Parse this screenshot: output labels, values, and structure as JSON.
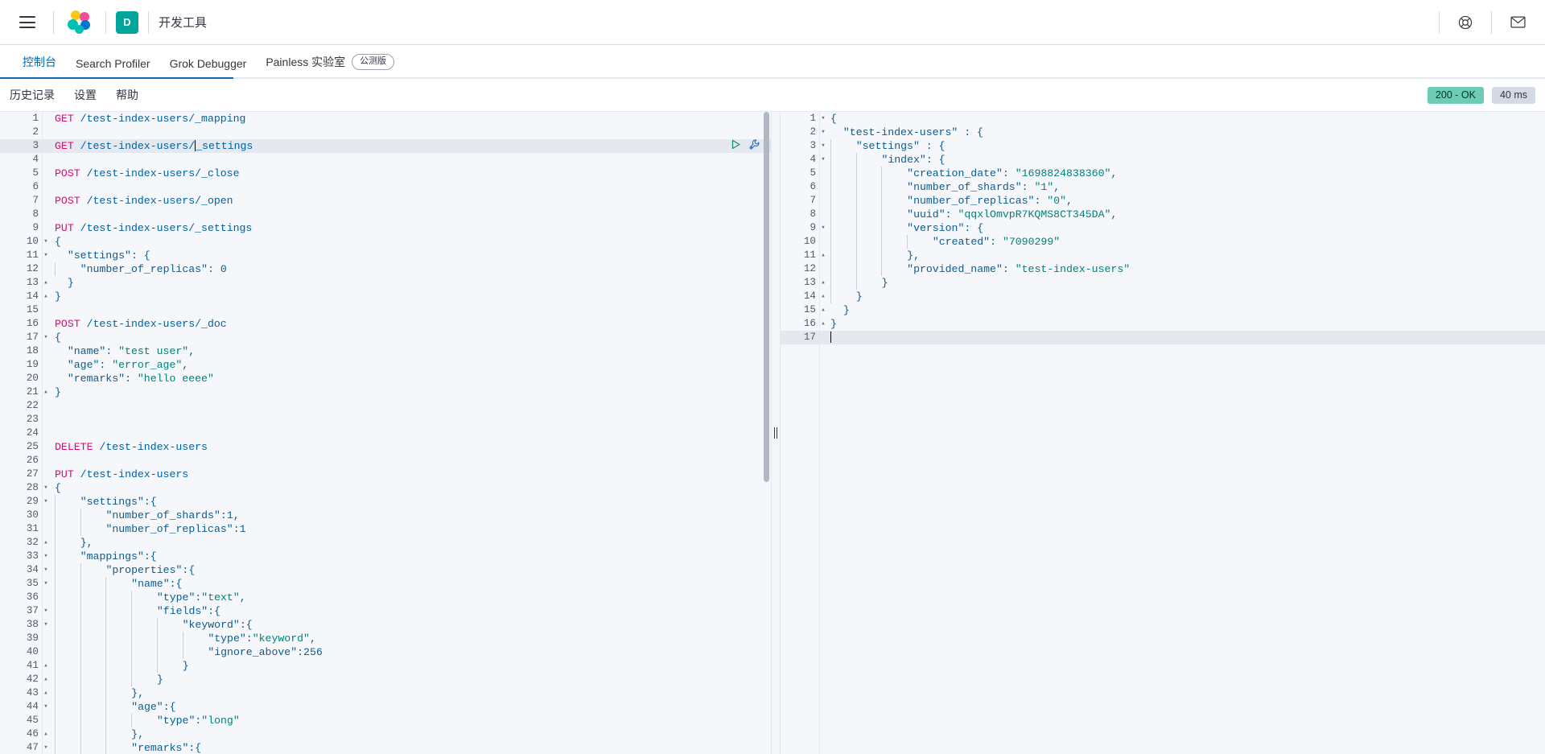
{
  "header": {
    "menu_icon": "hamburger-menu-icon",
    "logo_icon": "elastic-logo-icon",
    "space_initial": "D",
    "app_title": "开发工具",
    "help_icon": "lifebuoy-help-icon",
    "mail_icon": "envelope-icon"
  },
  "app_tabs": [
    {
      "label": "控制台",
      "active": true,
      "badge": null
    },
    {
      "label": "Search Profiler",
      "active": false,
      "badge": null
    },
    {
      "label": "Grok Debugger",
      "active": false,
      "badge": null
    },
    {
      "label": "Painless 实验室",
      "active": false,
      "badge": "公测版"
    }
  ],
  "console_bar": {
    "links": [
      "历史记录",
      "设置",
      "帮助"
    ],
    "status": "200 - OK",
    "time": "40 ms"
  },
  "colors": {
    "accent_blue": "#0071c2",
    "status_green": "#6dccb1",
    "time_grey": "#d3dae6",
    "method_pink": "#dd0a73",
    "string_green": "#00817a",
    "key_blue": "#0a5b8f",
    "teal_avatar": "#00a69b"
  },
  "editor": {
    "active_line": 3,
    "run_icon": "play-triangle-icon",
    "wrench_icon": "wrench-icon",
    "lines": [
      {
        "n": 1,
        "fold": "",
        "indent": 0,
        "tokens": [
          {
            "c": "m",
            "t": "GET"
          },
          {
            "c": "p",
            "t": " "
          },
          {
            "c": "u",
            "t": "/test-index-users/_mapping"
          }
        ]
      },
      {
        "n": 2,
        "fold": "",
        "indent": 0,
        "tokens": []
      },
      {
        "n": 3,
        "fold": "",
        "indent": 0,
        "active": true,
        "tokens": [
          {
            "c": "m",
            "t": "GET"
          },
          {
            "c": "p",
            "t": " "
          },
          {
            "c": "u",
            "t": "/test-index-users/"
          },
          {
            "c": "caret",
            "t": ""
          },
          {
            "c": "u",
            "t": "_settings"
          }
        ]
      },
      {
        "n": 4,
        "fold": "",
        "indent": 0,
        "tokens": []
      },
      {
        "n": 5,
        "fold": "",
        "indent": 0,
        "tokens": [
          {
            "c": "m",
            "t": "POST"
          },
          {
            "c": "p",
            "t": " "
          },
          {
            "c": "u",
            "t": "/test-index-users/_close"
          }
        ]
      },
      {
        "n": 6,
        "fold": "",
        "indent": 0,
        "tokens": []
      },
      {
        "n": 7,
        "fold": "",
        "indent": 0,
        "tokens": [
          {
            "c": "m",
            "t": "POST"
          },
          {
            "c": "p",
            "t": " "
          },
          {
            "c": "u",
            "t": "/test-index-users/_open"
          }
        ]
      },
      {
        "n": 8,
        "fold": "",
        "indent": 0,
        "tokens": []
      },
      {
        "n": 9,
        "fold": "",
        "indent": 0,
        "tokens": [
          {
            "c": "m",
            "t": "PUT"
          },
          {
            "c": "p",
            "t": " "
          },
          {
            "c": "u",
            "t": "/test-index-users/_settings"
          }
        ]
      },
      {
        "n": 10,
        "fold": "down",
        "indent": 0,
        "tokens": [
          {
            "c": "p",
            "t": "{"
          }
        ]
      },
      {
        "n": 11,
        "fold": "down",
        "indent": 0,
        "tokens": [
          {
            "c": "p",
            "t": "  "
          },
          {
            "c": "k",
            "t": "\"settings\""
          },
          {
            "c": "p",
            "t": ": {"
          }
        ]
      },
      {
        "n": 12,
        "fold": "",
        "indent": 1,
        "tokens": [
          {
            "c": "p",
            "t": "    "
          },
          {
            "c": "k",
            "t": "\"number_of_replicas\""
          },
          {
            "c": "p",
            "t": ": "
          },
          {
            "c": "n",
            "t": "0"
          }
        ]
      },
      {
        "n": 13,
        "fold": "up",
        "indent": 0,
        "tokens": [
          {
            "c": "p",
            "t": "  }"
          }
        ]
      },
      {
        "n": 14,
        "fold": "up",
        "indent": 0,
        "tokens": [
          {
            "c": "p",
            "t": "}"
          }
        ]
      },
      {
        "n": 15,
        "fold": "",
        "indent": 0,
        "tokens": []
      },
      {
        "n": 16,
        "fold": "",
        "indent": 0,
        "tokens": [
          {
            "c": "m",
            "t": "POST"
          },
          {
            "c": "p",
            "t": " "
          },
          {
            "c": "u",
            "t": "/test-index-users/_doc"
          }
        ]
      },
      {
        "n": 17,
        "fold": "down",
        "indent": 0,
        "tokens": [
          {
            "c": "p",
            "t": "{"
          }
        ]
      },
      {
        "n": 18,
        "fold": "",
        "indent": 0,
        "tokens": [
          {
            "c": "p",
            "t": "  "
          },
          {
            "c": "k",
            "t": "\"name\""
          },
          {
            "c": "p",
            "t": ": "
          },
          {
            "c": "s",
            "t": "\"test user\""
          },
          {
            "c": "p",
            "t": ","
          }
        ]
      },
      {
        "n": 19,
        "fold": "",
        "indent": 0,
        "tokens": [
          {
            "c": "p",
            "t": "  "
          },
          {
            "c": "k",
            "t": "\"age\""
          },
          {
            "c": "p",
            "t": ": "
          },
          {
            "c": "s",
            "t": "\"error_age\""
          },
          {
            "c": "p",
            "t": ","
          }
        ]
      },
      {
        "n": 20,
        "fold": "",
        "indent": 0,
        "tokens": [
          {
            "c": "p",
            "t": "  "
          },
          {
            "c": "k",
            "t": "\"remarks\""
          },
          {
            "c": "p",
            "t": ": "
          },
          {
            "c": "s",
            "t": "\"hello eeee\""
          }
        ]
      },
      {
        "n": 21,
        "fold": "up",
        "indent": 0,
        "tokens": [
          {
            "c": "p",
            "t": "}"
          }
        ]
      },
      {
        "n": 22,
        "fold": "",
        "indent": 0,
        "tokens": []
      },
      {
        "n": 23,
        "fold": "",
        "indent": 0,
        "tokens": []
      },
      {
        "n": 24,
        "fold": "",
        "indent": 0,
        "tokens": []
      },
      {
        "n": 25,
        "fold": "",
        "indent": 0,
        "tokens": [
          {
            "c": "m",
            "t": "DELETE"
          },
          {
            "c": "p",
            "t": " "
          },
          {
            "c": "u",
            "t": "/test-index-users"
          }
        ]
      },
      {
        "n": 26,
        "fold": "",
        "indent": 0,
        "tokens": []
      },
      {
        "n": 27,
        "fold": "",
        "indent": 0,
        "tokens": [
          {
            "c": "m",
            "t": "PUT"
          },
          {
            "c": "p",
            "t": " "
          },
          {
            "c": "u",
            "t": "/test-index-users"
          }
        ]
      },
      {
        "n": 28,
        "fold": "down",
        "indent": 0,
        "tokens": [
          {
            "c": "p",
            "t": "{"
          }
        ]
      },
      {
        "n": 29,
        "fold": "down",
        "indent": 1,
        "tokens": [
          {
            "c": "p",
            "t": "    "
          },
          {
            "c": "k",
            "t": "\"settings\""
          },
          {
            "c": "p",
            "t": ":{"
          }
        ]
      },
      {
        "n": 30,
        "fold": "",
        "indent": 2,
        "tokens": [
          {
            "c": "p",
            "t": "        "
          },
          {
            "c": "k",
            "t": "\"number_of_shards\""
          },
          {
            "c": "p",
            "t": ":"
          },
          {
            "c": "n",
            "t": "1"
          },
          {
            "c": "p",
            "t": ","
          }
        ]
      },
      {
        "n": 31,
        "fold": "",
        "indent": 2,
        "tokens": [
          {
            "c": "p",
            "t": "        "
          },
          {
            "c": "k",
            "t": "\"number_of_replicas\""
          },
          {
            "c": "p",
            "t": ":"
          },
          {
            "c": "n",
            "t": "1"
          }
        ]
      },
      {
        "n": 32,
        "fold": "up",
        "indent": 1,
        "tokens": [
          {
            "c": "p",
            "t": "    },"
          }
        ]
      },
      {
        "n": 33,
        "fold": "down",
        "indent": 1,
        "tokens": [
          {
            "c": "p",
            "t": "    "
          },
          {
            "c": "k",
            "t": "\"mappings\""
          },
          {
            "c": "p",
            "t": ":{"
          }
        ]
      },
      {
        "n": 34,
        "fold": "down",
        "indent": 2,
        "tokens": [
          {
            "c": "p",
            "t": "        "
          },
          {
            "c": "k",
            "t": "\"properties\""
          },
          {
            "c": "p",
            "t": ":{"
          }
        ]
      },
      {
        "n": 35,
        "fold": "down",
        "indent": 3,
        "tokens": [
          {
            "c": "p",
            "t": "            "
          },
          {
            "c": "k",
            "t": "\"name\""
          },
          {
            "c": "p",
            "t": ":{"
          }
        ]
      },
      {
        "n": 36,
        "fold": "",
        "indent": 4,
        "tokens": [
          {
            "c": "p",
            "t": "                "
          },
          {
            "c": "k",
            "t": "\"type\""
          },
          {
            "c": "p",
            "t": ":"
          },
          {
            "c": "s",
            "t": "\"text\""
          },
          {
            "c": "p",
            "t": ","
          }
        ]
      },
      {
        "n": 37,
        "fold": "down",
        "indent": 4,
        "tokens": [
          {
            "c": "p",
            "t": "                "
          },
          {
            "c": "k",
            "t": "\"fields\""
          },
          {
            "c": "p",
            "t": ":{"
          }
        ]
      },
      {
        "n": 38,
        "fold": "down",
        "indent": 5,
        "tokens": [
          {
            "c": "p",
            "t": "                    "
          },
          {
            "c": "k",
            "t": "\"keyword\""
          },
          {
            "c": "p",
            "t": ":{"
          }
        ]
      },
      {
        "n": 39,
        "fold": "",
        "indent": 6,
        "tokens": [
          {
            "c": "p",
            "t": "                        "
          },
          {
            "c": "k",
            "t": "\"type\""
          },
          {
            "c": "p",
            "t": ":"
          },
          {
            "c": "s",
            "t": "\"keyword\""
          },
          {
            "c": "p",
            "t": ","
          }
        ]
      },
      {
        "n": 40,
        "fold": "",
        "indent": 6,
        "tokens": [
          {
            "c": "p",
            "t": "                        "
          },
          {
            "c": "k",
            "t": "\"ignore_above\""
          },
          {
            "c": "p",
            "t": ":"
          },
          {
            "c": "n",
            "t": "256"
          }
        ]
      },
      {
        "n": 41,
        "fold": "up",
        "indent": 5,
        "tokens": [
          {
            "c": "p",
            "t": "                    }"
          }
        ]
      },
      {
        "n": 42,
        "fold": "up",
        "indent": 4,
        "tokens": [
          {
            "c": "p",
            "t": "                }"
          }
        ]
      },
      {
        "n": 43,
        "fold": "up",
        "indent": 3,
        "tokens": [
          {
            "c": "p",
            "t": "            },"
          }
        ]
      },
      {
        "n": 44,
        "fold": "down",
        "indent": 3,
        "tokens": [
          {
            "c": "p",
            "t": "            "
          },
          {
            "c": "k",
            "t": "\"age\""
          },
          {
            "c": "p",
            "t": ":{"
          }
        ]
      },
      {
        "n": 45,
        "fold": "",
        "indent": 4,
        "tokens": [
          {
            "c": "p",
            "t": "                "
          },
          {
            "c": "k",
            "t": "\"type\""
          },
          {
            "c": "p",
            "t": ":"
          },
          {
            "c": "s",
            "t": "\"long\""
          }
        ]
      },
      {
        "n": 46,
        "fold": "up",
        "indent": 3,
        "tokens": [
          {
            "c": "p",
            "t": "            },"
          }
        ]
      },
      {
        "n": 47,
        "fold": "down",
        "indent": 3,
        "tokens": [
          {
            "c": "p",
            "t": "            "
          },
          {
            "c": "k",
            "t": "\"remarks\""
          },
          {
            "c": "p",
            "t": ":{"
          }
        ]
      }
    ]
  },
  "response": {
    "active_line": 17,
    "lines": [
      {
        "n": 1,
        "fold": "down",
        "indent": 0,
        "tokens": [
          {
            "c": "p",
            "t": "{"
          }
        ]
      },
      {
        "n": 2,
        "fold": "down",
        "indent": 0,
        "tokens": [
          {
            "c": "p",
            "t": "  "
          },
          {
            "c": "k",
            "t": "\"test-index-users\""
          },
          {
            "c": "p",
            "t": " : {"
          }
        ]
      },
      {
        "n": 3,
        "fold": "down",
        "indent": 1,
        "tokens": [
          {
            "c": "p",
            "t": "    "
          },
          {
            "c": "k",
            "t": "\"settings\""
          },
          {
            "c": "p",
            "t": " : {"
          }
        ]
      },
      {
        "n": 4,
        "fold": "down",
        "indent": 2,
        "tokens": [
          {
            "c": "p",
            "t": "      "
          },
          {
            "c": "k",
            "t": "\"index\""
          },
          {
            "c": "p",
            "t": " : {"
          }
        ]
      },
      {
        "n": 5,
        "fold": "",
        "indent": 3,
        "tokens": [
          {
            "c": "p",
            "t": "        "
          },
          {
            "c": "k",
            "t": "\"creation_date\""
          },
          {
            "c": "p",
            "t": " : "
          },
          {
            "c": "s",
            "t": "\"1698824838360\""
          },
          {
            "c": "p",
            "t": ","
          }
        ]
      },
      {
        "n": 6,
        "fold": "",
        "indent": 3,
        "tokens": [
          {
            "c": "p",
            "t": "        "
          },
          {
            "c": "k",
            "t": "\"number_of_shards\""
          },
          {
            "c": "p",
            "t": " : "
          },
          {
            "c": "s",
            "t": "\"1\""
          },
          {
            "c": "p",
            "t": ","
          }
        ]
      },
      {
        "n": 7,
        "fold": "",
        "indent": 3,
        "tokens": [
          {
            "c": "p",
            "t": "        "
          },
          {
            "c": "k",
            "t": "\"number_of_replicas\""
          },
          {
            "c": "p",
            "t": " : "
          },
          {
            "c": "s",
            "t": "\"0\""
          },
          {
            "c": "p",
            "t": ","
          }
        ]
      },
      {
        "n": 8,
        "fold": "",
        "indent": 3,
        "tokens": [
          {
            "c": "p",
            "t": "        "
          },
          {
            "c": "k",
            "t": "\"uuid\""
          },
          {
            "c": "p",
            "t": " : "
          },
          {
            "c": "s",
            "t": "\"qqxlOmvpR7KQMS8CT345DA\""
          },
          {
            "c": "p",
            "t": ","
          }
        ]
      },
      {
        "n": 9,
        "fold": "down",
        "indent": 3,
        "tokens": [
          {
            "c": "p",
            "t": "        "
          },
          {
            "c": "k",
            "t": "\"version\""
          },
          {
            "c": "p",
            "t": " : {"
          }
        ]
      },
      {
        "n": 10,
        "fold": "",
        "indent": 4,
        "tokens": [
          {
            "c": "p",
            "t": "          "
          },
          {
            "c": "k",
            "t": "\"created\""
          },
          {
            "c": "p",
            "t": " : "
          },
          {
            "c": "s",
            "t": "\"7090299\""
          }
        ]
      },
      {
        "n": 11,
        "fold": "up",
        "indent": 3,
        "tokens": [
          {
            "c": "p",
            "t": "        },"
          }
        ]
      },
      {
        "n": 12,
        "fold": "",
        "indent": 3,
        "tokens": [
          {
            "c": "p",
            "t": "        "
          },
          {
            "c": "k",
            "t": "\"provided_name\""
          },
          {
            "c": "p",
            "t": " : "
          },
          {
            "c": "s",
            "t": "\"test-index-users\""
          }
        ]
      },
      {
        "n": 13,
        "fold": "up",
        "indent": 2,
        "tokens": [
          {
            "c": "p",
            "t": "      }"
          }
        ]
      },
      {
        "n": 14,
        "fold": "up",
        "indent": 1,
        "tokens": [
          {
            "c": "p",
            "t": "    }"
          }
        ]
      },
      {
        "n": 15,
        "fold": "up",
        "indent": 0,
        "tokens": [
          {
            "c": "p",
            "t": "  }"
          }
        ]
      },
      {
        "n": 16,
        "fold": "up",
        "indent": 0,
        "tokens": [
          {
            "c": "p",
            "t": "}"
          }
        ]
      },
      {
        "n": 17,
        "fold": "",
        "indent": 0,
        "active": true,
        "tokens": [
          {
            "c": "caret",
            "t": ""
          }
        ]
      }
    ]
  },
  "resizer": {
    "name": "pane-resizer",
    "glyph": "||"
  }
}
